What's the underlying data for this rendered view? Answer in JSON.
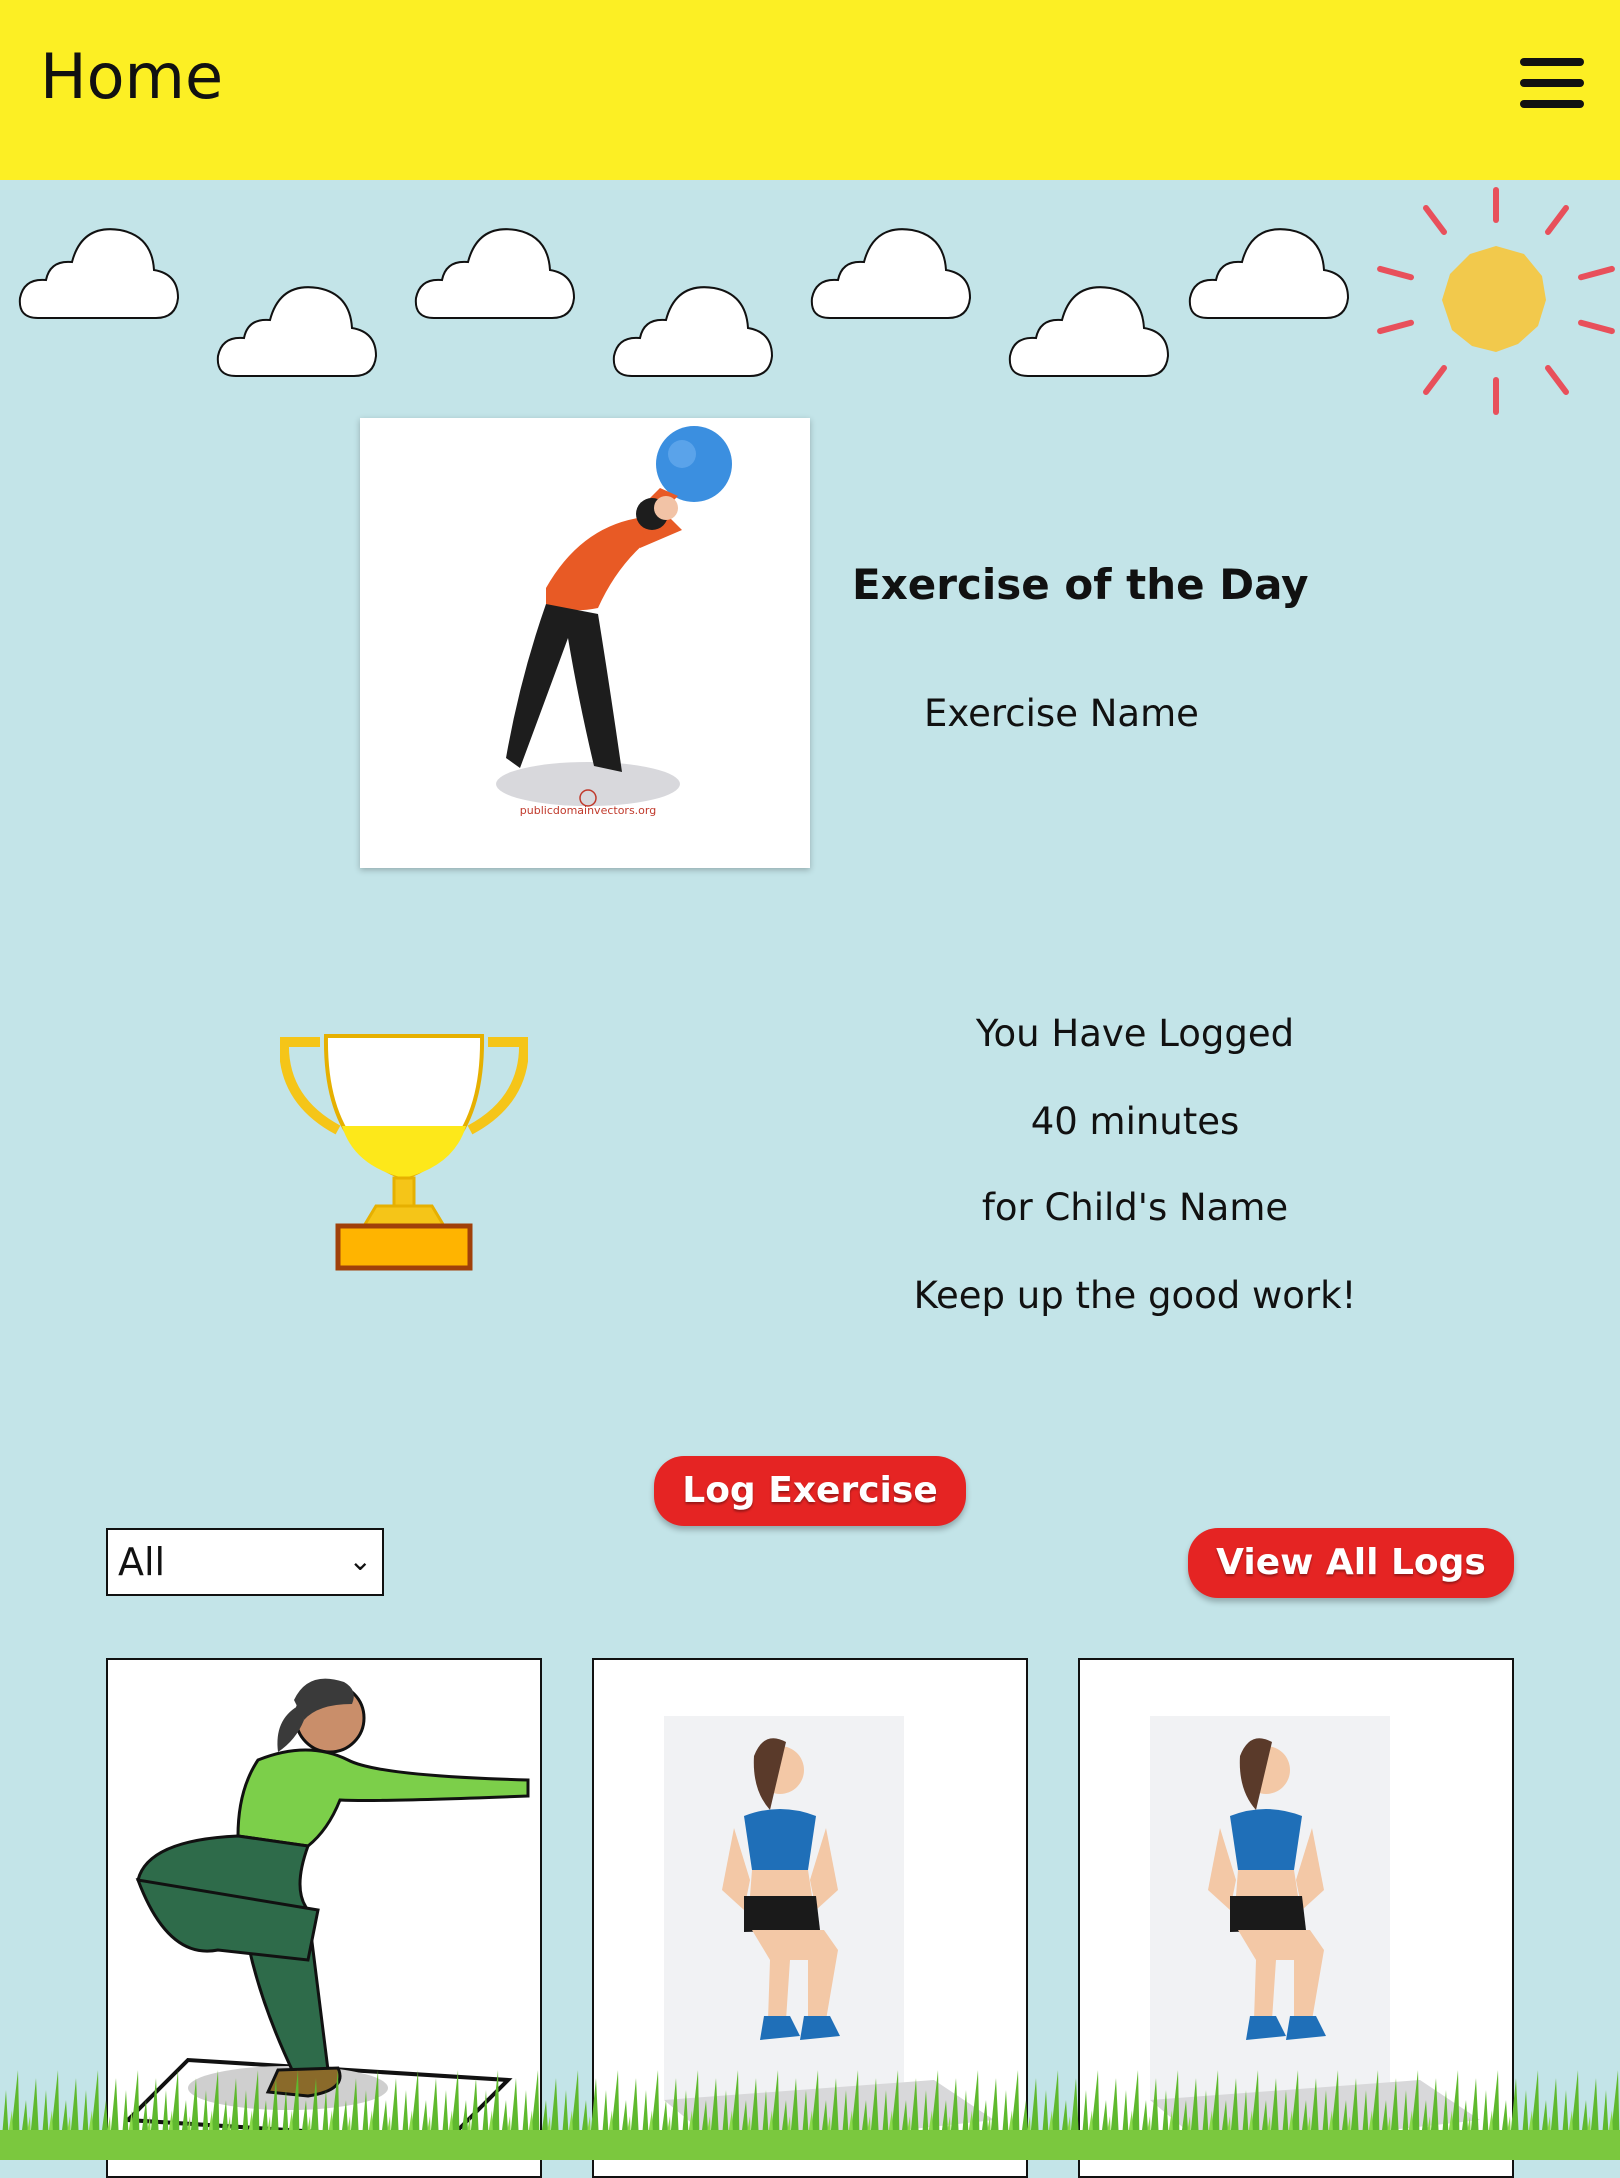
{
  "header": {
    "title": "Home",
    "menu_icon": "hamburger-menu-icon",
    "background": "#fcef24"
  },
  "exercise_of_day": {
    "heading": "Exercise of the Day",
    "exercise_name": "Exercise Name",
    "image_caption": "publicdomainvectors.org"
  },
  "progress": {
    "line1": "You Have Logged",
    "line2": "40 minutes",
    "line3": "for Child's Name",
    "line4": "Keep up the good work!"
  },
  "actions": {
    "log_exercise": "Log Exercise",
    "view_all_logs": "View All Logs",
    "button_color": "#e52423"
  },
  "filter": {
    "selected": "All"
  },
  "exercise_cards": [
    {
      "icon": "squat-exercise-illustration"
    },
    {
      "icon": "wall-sit-exercise-illustration"
    },
    {
      "icon": "wall-sit-exercise-illustration"
    }
  ],
  "colors": {
    "sky": "#c3e4e8",
    "sun": "#f2c94c",
    "sun_rays": "#e8505b"
  }
}
